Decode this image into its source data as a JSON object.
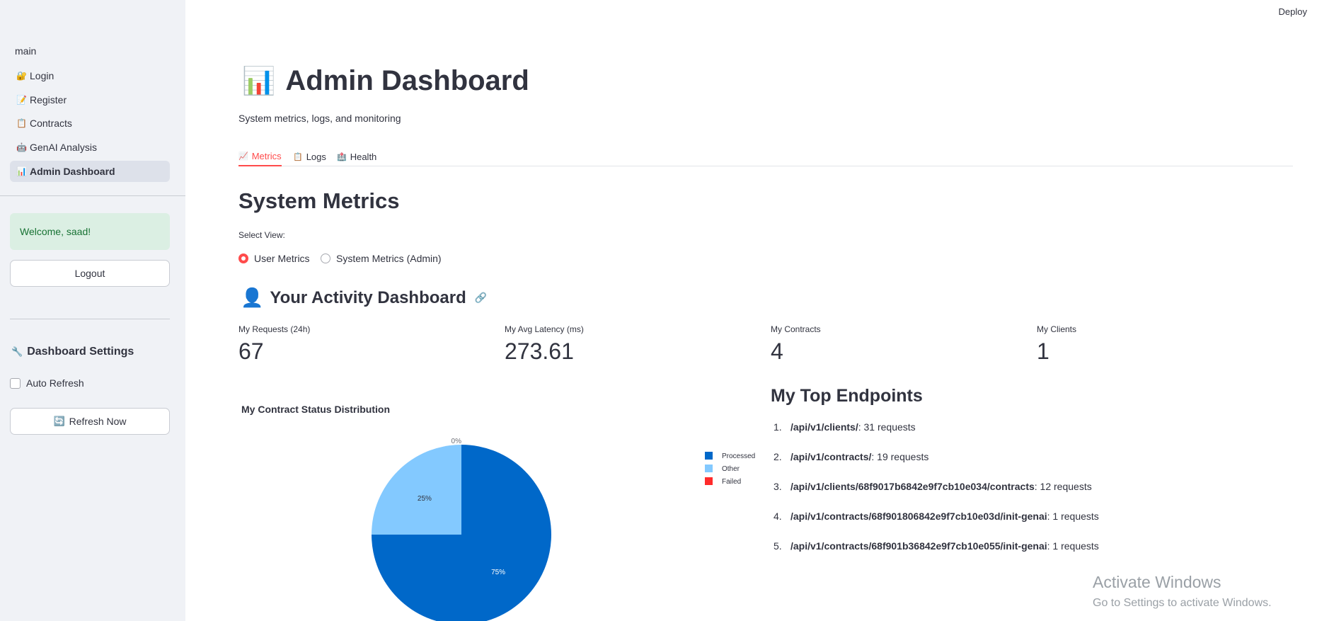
{
  "sidebar": {
    "nav_title": "main",
    "items": [
      {
        "label": "Login",
        "icon": "🔐"
      },
      {
        "label": "Register",
        "icon": "📝"
      },
      {
        "label": "Contracts",
        "icon": "📋"
      },
      {
        "label": "GenAI Analysis",
        "icon": "🤖"
      },
      {
        "label": "Admin Dashboard",
        "icon": "📊"
      }
    ],
    "welcome": "Welcome, saad!",
    "logout_label": "Logout",
    "settings_heading": "Dashboard Settings",
    "settings_icon": "🔧",
    "auto_refresh_label": "Auto Refresh",
    "refresh_label": "Refresh Now",
    "refresh_icon": "🔄"
  },
  "header": {
    "deploy_label": "Deploy"
  },
  "page": {
    "title": "Admin Dashboard",
    "title_icon": "📊",
    "subtitle": "System metrics, logs, and monitoring"
  },
  "tabs": [
    {
      "label": "Metrics",
      "icon": "📈"
    },
    {
      "label": "Logs",
      "icon": "📋"
    },
    {
      "label": "Health",
      "icon": "🏥"
    }
  ],
  "section_title": "System Metrics",
  "select_view": {
    "label": "Select View:",
    "options": [
      "User Metrics",
      "System Metrics (Admin)"
    ]
  },
  "activity": {
    "title": "Your Activity Dashboard",
    "icon": "👤",
    "metrics": [
      {
        "label": "My Requests (24h)",
        "value": "67"
      },
      {
        "label": "My Avg Latency (ms)",
        "value": "273.61"
      },
      {
        "label": "My Contracts",
        "value": "4"
      },
      {
        "label": "My Clients",
        "value": "1"
      }
    ]
  },
  "chart_data": {
    "type": "pie",
    "title": "My Contract Status Distribution",
    "categories": [
      "Processed",
      "Other",
      "Failed"
    ],
    "values": [
      75,
      25,
      0
    ],
    "labels": [
      "75%",
      "25%",
      "0%"
    ],
    "colors": [
      "#0068c9",
      "#83c9ff",
      "#ff2b2b"
    ],
    "legend": "right"
  },
  "endpoints": {
    "title": "My Top Endpoints",
    "items": [
      {
        "path": "/api/v1/clients/",
        "count": ": 31 requests"
      },
      {
        "path": "/api/v1/contracts/",
        "count": ": 19 requests"
      },
      {
        "path": "/api/v1/clients/68f9017b6842e9f7cb10e034/contracts",
        "count": ": 12 requests"
      },
      {
        "path": "/api/v1/contracts/68f901806842e9f7cb10e03d/init-genai",
        "count": ": 1 requests"
      },
      {
        "path": "/api/v1/contracts/68f901b36842e9f7cb10e055/init-genai",
        "count": ": 1 requests"
      }
    ]
  },
  "watermark": {
    "line1": "Activate Windows",
    "line2": "Go to Settings to activate Windows."
  }
}
